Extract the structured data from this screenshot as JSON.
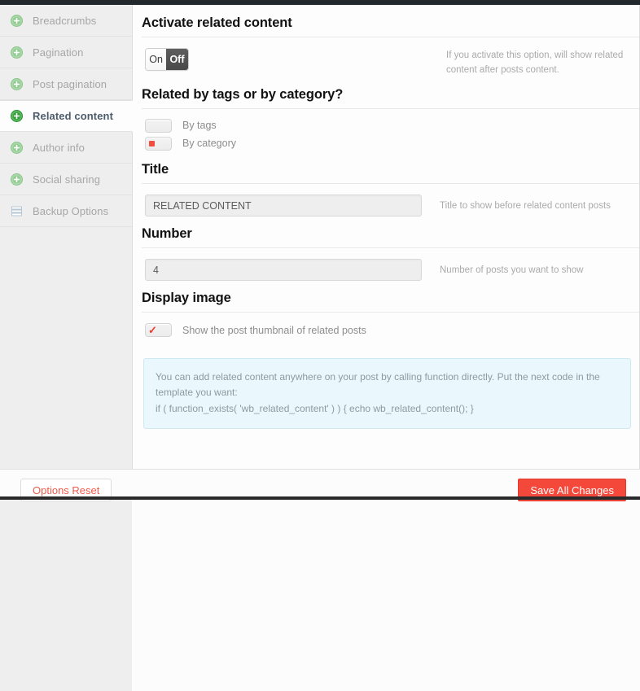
{
  "sidebar": {
    "items": [
      {
        "label": "Breadcrumbs",
        "icon": "circle-plus-icon",
        "active": false
      },
      {
        "label": "Pagination",
        "icon": "circle-plus-icon",
        "active": false
      },
      {
        "label": "Post pagination",
        "icon": "circle-plus-icon",
        "active": false
      },
      {
        "label": "Related content",
        "icon": "circle-plus-icon",
        "active": true
      },
      {
        "label": "Author info",
        "icon": "circle-plus-icon",
        "active": false
      },
      {
        "label": "Social sharing",
        "icon": "circle-plus-icon",
        "active": false
      },
      {
        "label": "Backup Options",
        "icon": "layers-icon",
        "active": false
      }
    ]
  },
  "sections": {
    "activate": {
      "title": "Activate related content",
      "toggle": {
        "on_label": "On",
        "off_label": "Off",
        "selected": "Off"
      },
      "description": "If you activate this option, will show related content after posts content."
    },
    "related_by": {
      "title": "Related by tags or by category?",
      "options": [
        {
          "label": "By tags",
          "checked": false
        },
        {
          "label": "By category",
          "checked": true
        }
      ]
    },
    "title_field": {
      "title": "Title",
      "value": "RELATED CONTENT",
      "description": "Title to show before related content posts"
    },
    "number_field": {
      "title": "Number",
      "value": "4",
      "description": "Number of posts you want to show"
    },
    "display_image": {
      "title": "Display image",
      "checkbox_label": "Show the post thumbnail of related posts",
      "checked": true
    }
  },
  "notice": {
    "text": "You can add related content anywhere on your post by calling function directly. Put the next code in the template you want:",
    "code": "if ( function_exists( 'wb_related_content' ) ) { echo wb_related_content(); }"
  },
  "footer": {
    "reset_label": "Options Reset",
    "save_label": "Save All Changes"
  },
  "colors": {
    "accent_red": "#f4483b",
    "reset_text": "#f05a4a",
    "icon_green": "#8cc98c",
    "icon_green_active": "#33a23a",
    "notice_bg": "#eaf7fc",
    "notice_border": "#cfe9f3"
  }
}
